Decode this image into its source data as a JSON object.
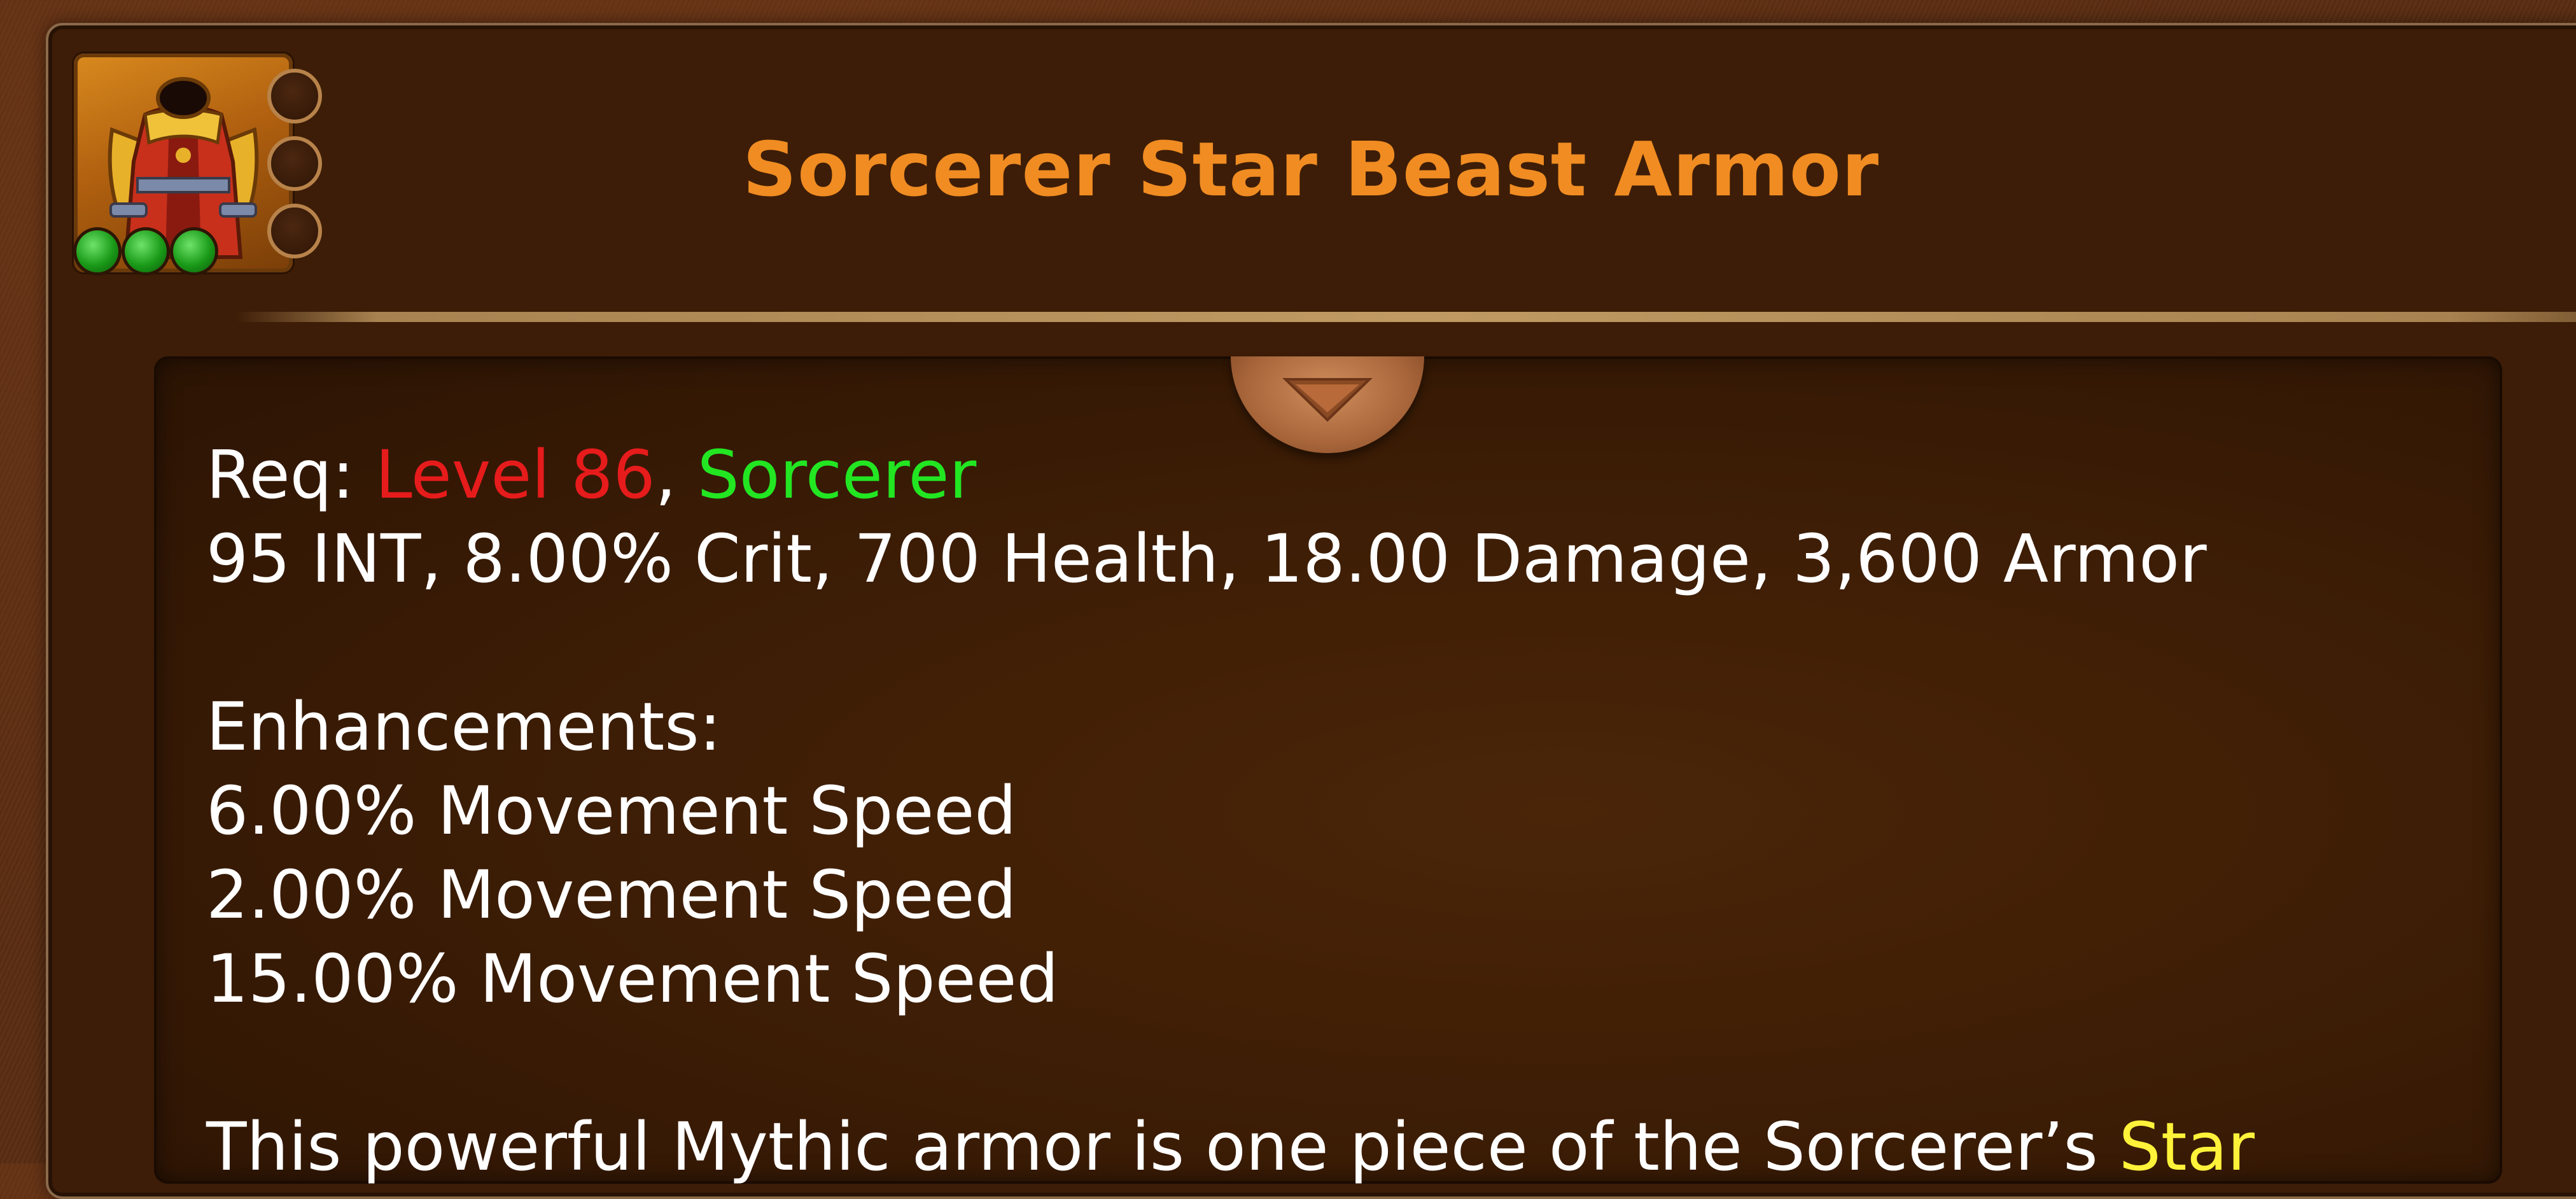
{
  "item": {
    "name": "Sorcerer Star Beast Armor",
    "icon": "robe-armor-icon",
    "gems_filled": 3,
    "sockets": 3
  },
  "requirements": {
    "label": "Req: ",
    "level": "Level 86",
    "separator": ", ",
    "class": "Sorcerer"
  },
  "stats": "95 INT, 8.00% Crit, 700 Health, 18.00 Damage, 3,600 Armor",
  "enhancements": {
    "header": "Enhancements:",
    "items": [
      "6.00% Movement Speed",
      "2.00% Movement Speed",
      "15.00% Movement Speed"
    ]
  },
  "description": {
    "text": "This powerful Mythic armor is one piece of the Sorcerer’s ",
    "set_link": "Star"
  },
  "colors": {
    "title": "#f08c22",
    "level_requirement": "#e61b1b",
    "class_requirement": "#22e622",
    "set_link": "#fff23a",
    "panel": "#3d1d07"
  }
}
